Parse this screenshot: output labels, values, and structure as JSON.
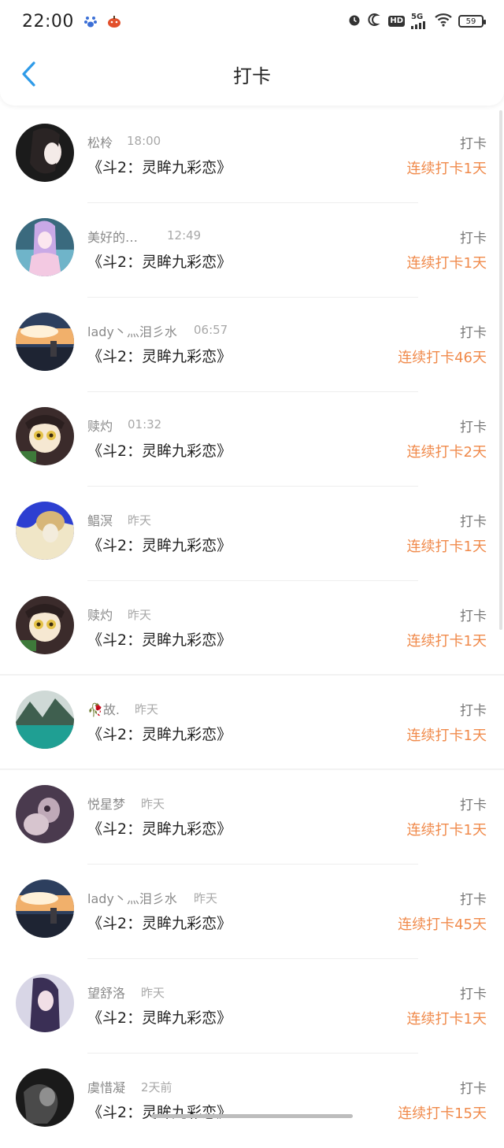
{
  "status_bar": {
    "time": "22:00",
    "battery": "59",
    "network": "5G",
    "hd": "HD"
  },
  "header": {
    "title": "打卡"
  },
  "colors": {
    "accent_blue": "#2f9be8",
    "streak_orange": "#f08a4b"
  },
  "items": [
    {
      "name": "松柃",
      "time": "18:00",
      "book": "《斗2：灵眸九彩恋》",
      "action": "打卡",
      "streak": "连续打卡1天"
    },
    {
      "name": "美好的…",
      "time": "12:49",
      "book": "《斗2：灵眸九彩恋》",
      "action": "打卡",
      "streak": "连续打卡1天"
    },
    {
      "name": "lady丶灬泪彡水",
      "time": "06:57",
      "book": "《斗2：灵眸九彩恋》",
      "action": "打卡",
      "streak": "连续打卡46天"
    },
    {
      "name": "赎灼",
      "time": "01:32",
      "book": "《斗2：灵眸九彩恋》",
      "action": "打卡",
      "streak": "连续打卡2天"
    },
    {
      "name": "鲳溟",
      "time": "昨天",
      "book": "《斗2：灵眸九彩恋》",
      "action": "打卡",
      "streak": "连续打卡1天"
    },
    {
      "name": "赎灼",
      "time": "昨天",
      "book": "《斗2：灵眸九彩恋》",
      "action": "打卡",
      "streak": "连续打卡1天"
    },
    {
      "name": "🥀故.",
      "time": "昨天",
      "book": "《斗2：灵眸九彩恋》",
      "action": "打卡",
      "streak": "连续打卡1天"
    },
    {
      "name": "悦星梦",
      "time": "昨天",
      "book": "《斗2：灵眸九彩恋》",
      "action": "打卡",
      "streak": "连续打卡1天"
    },
    {
      "name": "lady丶灬泪彡水",
      "time": "昨天",
      "book": "《斗2：灵眸九彩恋》",
      "action": "打卡",
      "streak": "连续打卡45天"
    },
    {
      "name": "望舒洛",
      "time": "昨天",
      "book": "《斗2：灵眸九彩恋》",
      "action": "打卡",
      "streak": "连续打卡1天"
    },
    {
      "name": "虞惜凝",
      "time": "2天前",
      "book": "《斗2：灵眸九彩恋》",
      "action": "打卡",
      "streak": "连续打卡15天"
    }
  ]
}
